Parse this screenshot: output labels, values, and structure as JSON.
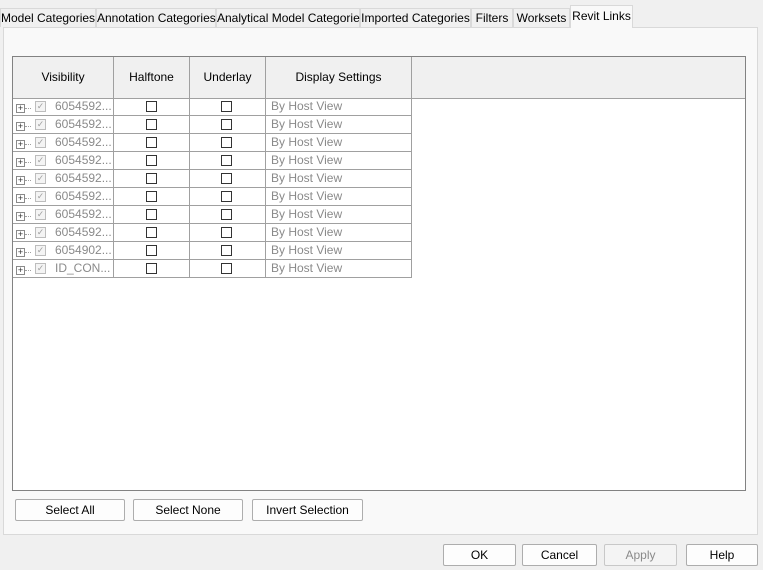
{
  "tabs": [
    {
      "label": "Model Categories",
      "active": false
    },
    {
      "label": "Annotation Categories",
      "active": false
    },
    {
      "label": "Analytical Model Categories",
      "active": false
    },
    {
      "label": "Imported Categories",
      "active": false
    },
    {
      "label": "Filters",
      "active": false
    },
    {
      "label": "Worksets",
      "active": false
    },
    {
      "label": "Revit Links",
      "active": true
    }
  ],
  "table": {
    "headers": [
      "Visibility",
      "Halftone",
      "Underlay",
      "Display Settings"
    ],
    "rows": [
      {
        "name": "6054592...",
        "visible": true,
        "halftone": false,
        "underlay": false,
        "display": "By Host View"
      },
      {
        "name": "6054592...",
        "visible": true,
        "halftone": false,
        "underlay": false,
        "display": "By Host View"
      },
      {
        "name": "6054592...",
        "visible": true,
        "halftone": false,
        "underlay": false,
        "display": "By Host View"
      },
      {
        "name": "6054592...",
        "visible": true,
        "halftone": false,
        "underlay": false,
        "display": "By Host View"
      },
      {
        "name": "6054592...",
        "visible": true,
        "halftone": false,
        "underlay": false,
        "display": "By Host View"
      },
      {
        "name": "6054592...",
        "visible": true,
        "halftone": false,
        "underlay": false,
        "display": "By Host View"
      },
      {
        "name": "6054592...",
        "visible": true,
        "halftone": false,
        "underlay": false,
        "display": "By Host View"
      },
      {
        "name": "6054592...",
        "visible": true,
        "halftone": false,
        "underlay": false,
        "display": "By Host View"
      },
      {
        "name": "6054902...",
        "visible": true,
        "halftone": false,
        "underlay": false,
        "display": "By Host View"
      },
      {
        "name": "ID_CON...",
        "visible": true,
        "halftone": false,
        "underlay": false,
        "display": "By Host View"
      }
    ]
  },
  "selection_buttons": {
    "select_all": "Select All",
    "select_none": "Select None",
    "invert_selection": "Invert Selection"
  },
  "dialog_buttons": {
    "ok": "OK",
    "cancel": "Cancel",
    "apply": "Apply",
    "help": "Help"
  },
  "icons": {
    "expander": "plus-box-icon",
    "checkmark": "✓"
  }
}
